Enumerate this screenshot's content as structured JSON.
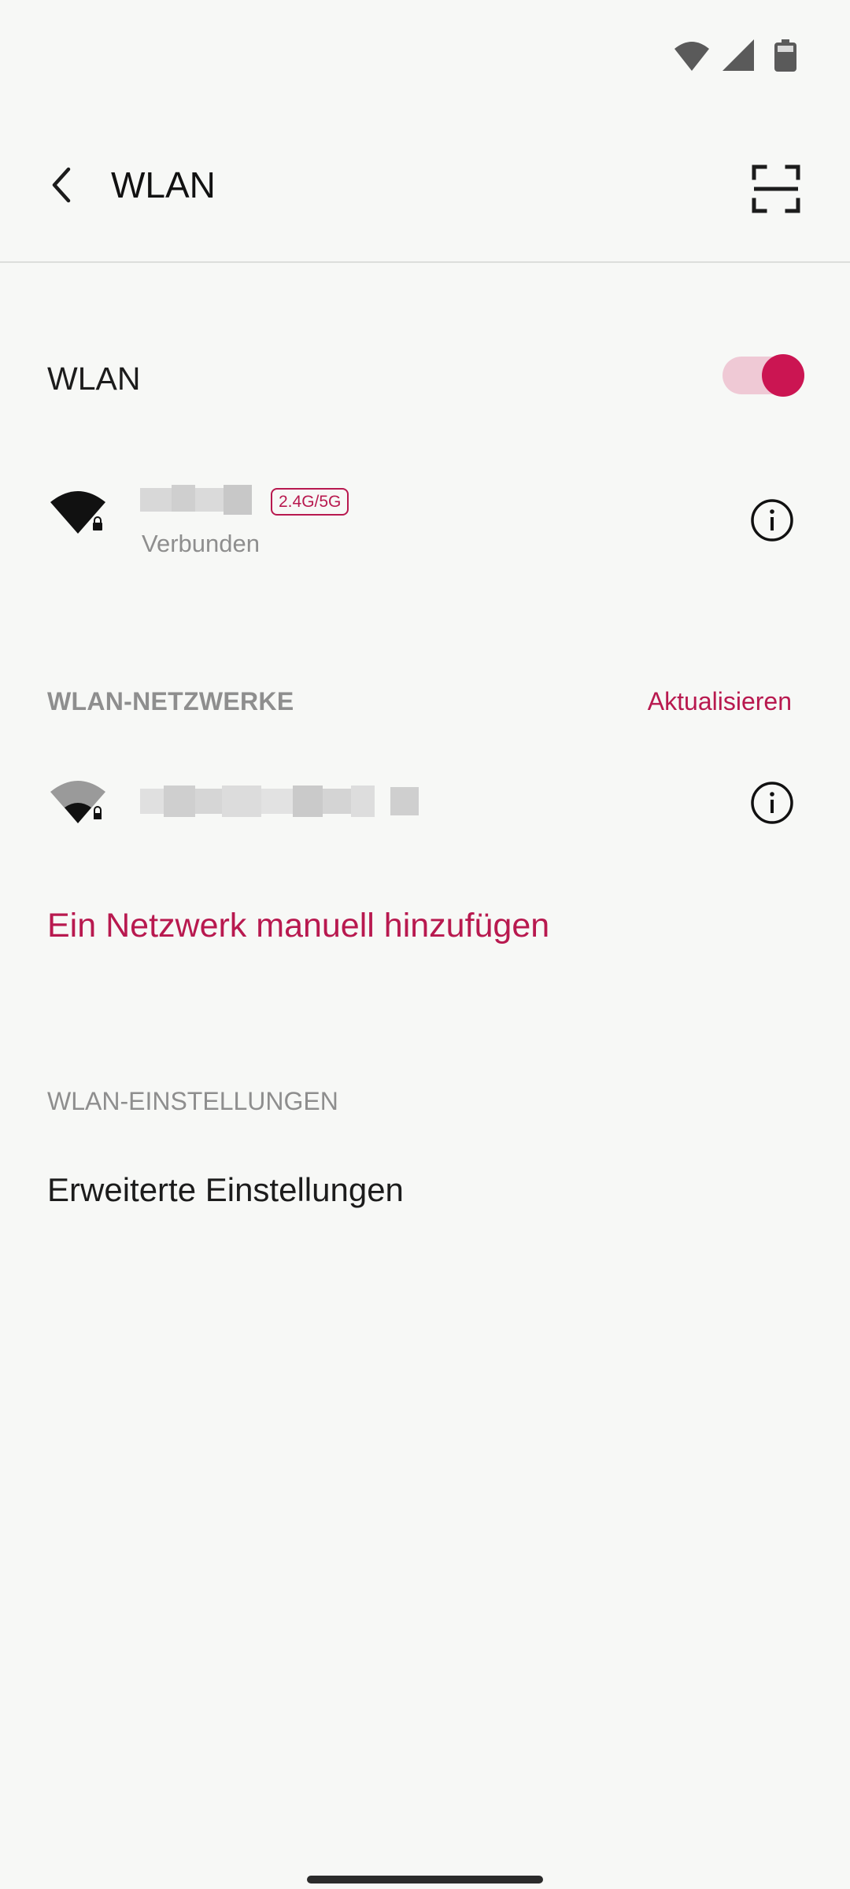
{
  "status_bar": {
    "icons": [
      "wifi-icon",
      "cell-signal-icon",
      "battery-icon"
    ]
  },
  "app_bar": {
    "title": "WLAN",
    "back_icon": "chevron-left-icon",
    "scan_icon": "qr-scan-icon"
  },
  "wifi_toggle": {
    "label": "WLAN",
    "state": "on"
  },
  "connected_network": {
    "band": "2.4G/5G",
    "status": "Verbunden",
    "icon": "wifi-full-lock-icon"
  },
  "networks_section": {
    "header": "WLAN-NETZWERKE",
    "refresh_label": "Aktualisieren",
    "networks": [
      {
        "icon": "wifi-weak-lock-icon"
      }
    ]
  },
  "add_network_label": "Ein Netzwerk manuell hinzufügen",
  "settings_section": {
    "header": "WLAN-EINSTELLUNGEN",
    "advanced_label": "Erweiterte Einstellungen"
  },
  "colors": {
    "accent": "#b8194f",
    "toggle_thumb": "#cb1552",
    "toggle_track": "#efc9d5",
    "background": "#f7f8f6",
    "secondary_text": "#8e8e8e"
  }
}
